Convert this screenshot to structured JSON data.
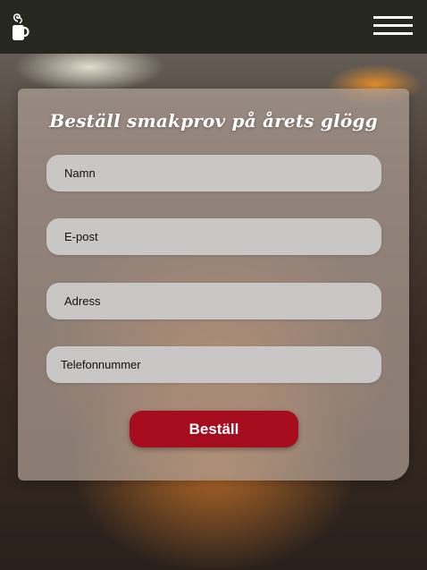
{
  "header": {
    "logo_icon": "mug-with-steam-icon",
    "menu_icon": "hamburger-menu-icon"
  },
  "form": {
    "title": "Beställ smakprov på årets glögg",
    "name_placeholder": "Namn",
    "email_placeholder": "E-post",
    "address_placeholder": "Adress",
    "phone_placeholder": "Telefonnummer",
    "submit_label": "Beställ"
  },
  "colors": {
    "header_bg": "#262820",
    "submit_bg": "#a50c1e",
    "field_bg": "#c9c7c5"
  }
}
